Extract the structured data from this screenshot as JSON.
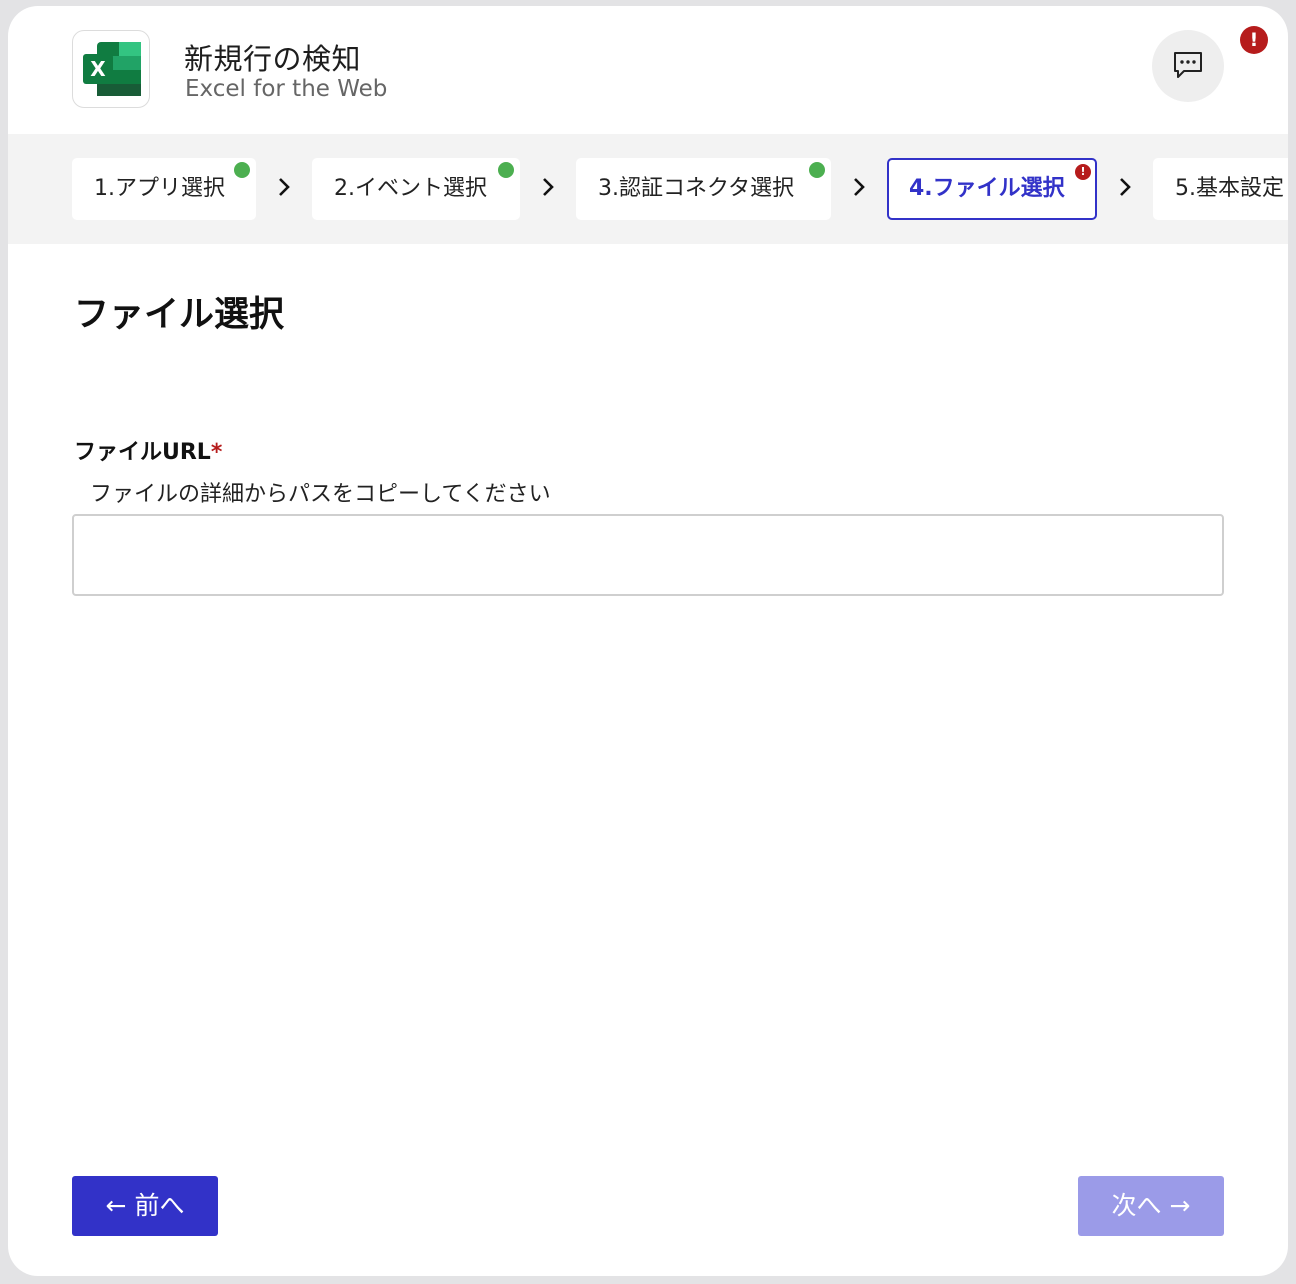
{
  "header": {
    "title": "新規行の検知",
    "subtitle": "Excel for the Web",
    "alert_badge": "!"
  },
  "steps": [
    {
      "label": "1.アプリ選択",
      "status": "done"
    },
    {
      "label": "2.イベント選択",
      "status": "done"
    },
    {
      "label": "3.認証コネクタ選択",
      "status": "done"
    },
    {
      "label": "4.ファイル選択",
      "status": "error",
      "active": true
    },
    {
      "label": "5.基本設定",
      "status": "pending"
    }
  ],
  "main": {
    "section_title": "ファイル選択",
    "field_label": "ファイルURL",
    "required_mark": "*",
    "field_hint": "ファイルの詳細からパスをコピーしてください",
    "field_value": ""
  },
  "footer": {
    "prev_label": "← 前へ",
    "next_label": "次へ →"
  },
  "colors": {
    "accent": "#3232c8",
    "accent_disabled": "#9b9be8",
    "success": "#4caf50",
    "error": "#b61c1c"
  }
}
